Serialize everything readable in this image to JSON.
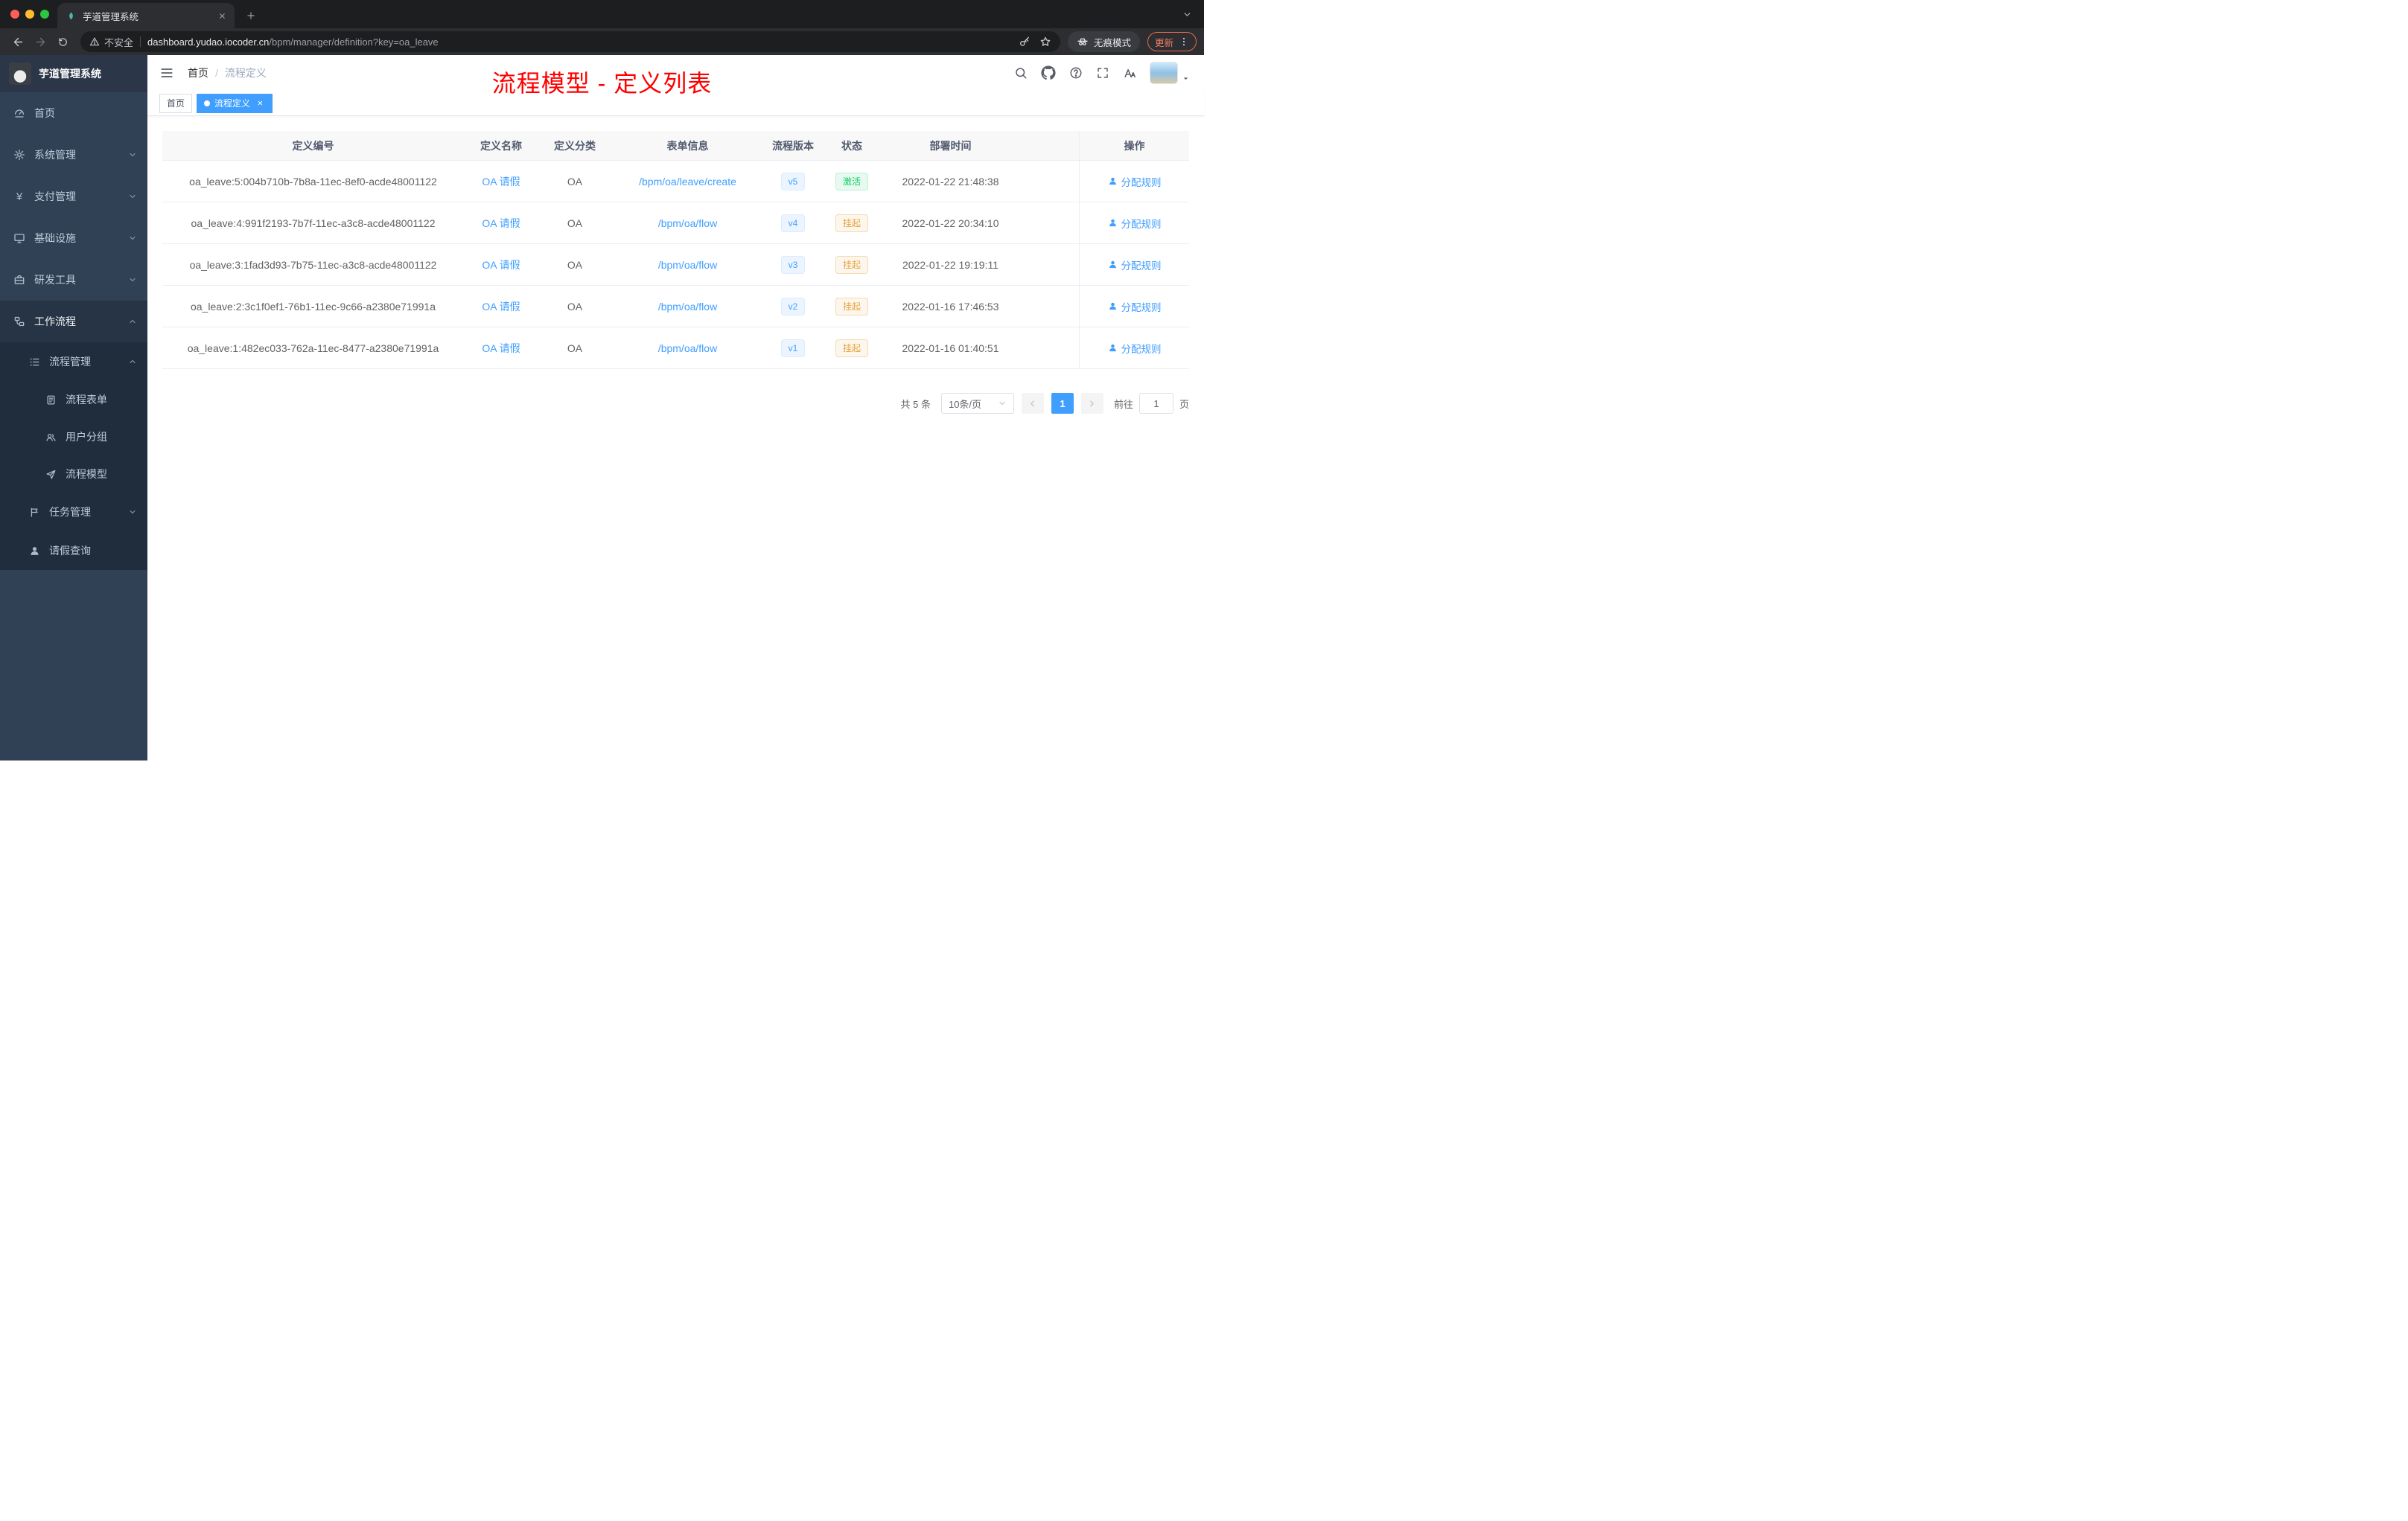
{
  "browser": {
    "tab_title": "芋道管理系统",
    "security_label": "不安全",
    "url_host": "dashboard.yudao.iocoder.cn",
    "url_path": "/bpm/manager/definition?key=oa_leave",
    "incognito_label": "无痕模式",
    "update_label": "更新"
  },
  "sidebar": {
    "logo_title": "芋道管理系统",
    "items": [
      {
        "label": "首页"
      },
      {
        "label": "系统管理"
      },
      {
        "label": "支付管理"
      },
      {
        "label": "基础设施"
      },
      {
        "label": "研发工具"
      },
      {
        "label": "工作流程"
      },
      {
        "label": "流程管理"
      },
      {
        "label": "流程表单"
      },
      {
        "label": "用户分组"
      },
      {
        "label": "流程模型"
      },
      {
        "label": "任务管理"
      },
      {
        "label": "请假查询"
      }
    ]
  },
  "header": {
    "breadcrumb_home": "首页",
    "breadcrumb_separator": "/",
    "breadcrumb_current": "流程定义",
    "annotation": "流程模型 - 定义列表"
  },
  "tags": {
    "home": "首页",
    "current": "流程定义"
  },
  "table": {
    "columns": [
      "定义编号",
      "定义名称",
      "定义分类",
      "表单信息",
      "流程版本",
      "状态",
      "部署时间",
      "操作"
    ],
    "rows": [
      {
        "id": "oa_leave:5:004b710b-7b8a-11ec-8ef0-acde48001122",
        "name": "OA 请假",
        "category": "OA",
        "form": "/bpm/oa/leave/create",
        "version": "v5",
        "status": "激活",
        "time": "2022-01-22 21:48:38",
        "action": "分配规则"
      },
      {
        "id": "oa_leave:4:991f2193-7b7f-11ec-a3c8-acde48001122",
        "name": "OA 请假",
        "category": "OA",
        "form": "/bpm/oa/flow",
        "version": "v4",
        "status": "挂起",
        "time": "2022-01-22 20:34:10",
        "action": "分配规则"
      },
      {
        "id": "oa_leave:3:1fad3d93-7b75-11ec-a3c8-acde48001122",
        "name": "OA 请假",
        "category": "OA",
        "form": "/bpm/oa/flow",
        "version": "v3",
        "status": "挂起",
        "time": "2022-01-22 19:19:11",
        "action": "分配规则"
      },
      {
        "id": "oa_leave:2:3c1f0ef1-76b1-11ec-9c66-a2380e71991a",
        "name": "OA 请假",
        "category": "OA",
        "form": "/bpm/oa/flow",
        "version": "v2",
        "status": "挂起",
        "time": "2022-01-16 17:46:53",
        "action": "分配规则"
      },
      {
        "id": "oa_leave:1:482ec033-762a-11ec-8477-a2380e71991a",
        "name": "OA 请假",
        "category": "OA",
        "form": "/bpm/oa/flow",
        "version": "v1",
        "status": "挂起",
        "time": "2022-01-16 01:40:51",
        "action": "分配规则"
      }
    ]
  },
  "pagination": {
    "total": "共 5 条",
    "page_size": "10条/页",
    "page": "1",
    "goto_label": "前往",
    "goto_value": "1",
    "unit": "页"
  },
  "colors": {
    "accent_blue": "#409eff",
    "success_green": "#13ce66",
    "warning_orange": "#e6a23c",
    "annotation_red": "#ff0000",
    "sidebar_bg": "#304156",
    "submenu_bg": "#1f2d3d"
  }
}
